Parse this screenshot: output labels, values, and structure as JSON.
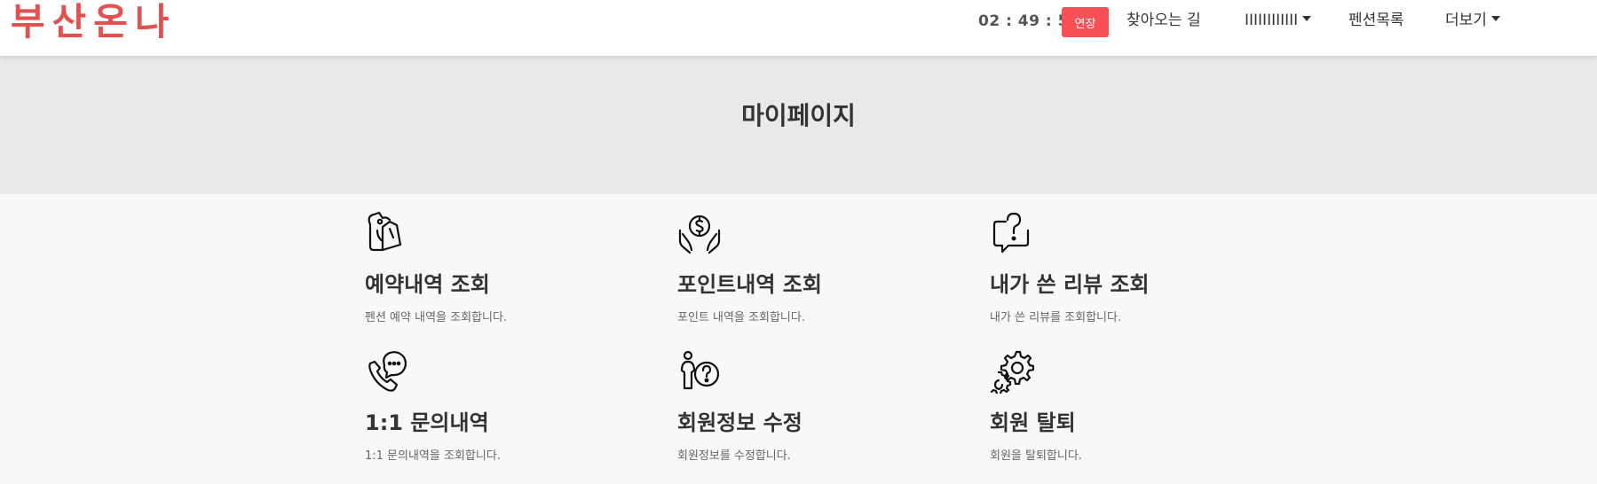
{
  "header": {
    "logo": "부산온나",
    "timer": "02 : 49 : 53",
    "extend_label": "연장",
    "nav": [
      {
        "label": "찾아오는 길"
      },
      {
        "label": "IIIIIIIIIIII"
      },
      {
        "label": "펜션목록"
      },
      {
        "label": "더보기"
      }
    ]
  },
  "hero": {
    "title": "마이페이지"
  },
  "cards": [
    {
      "title": "예약내역 조회",
      "desc": "펜션 예약 내역을 조회합니다.",
      "icon": "reservation-icon"
    },
    {
      "title": "포인트내역 조회",
      "desc": "포인트 내역을 조회합니다.",
      "icon": "point-coin-icon"
    },
    {
      "title": "내가 쓴 리뷰 조회",
      "desc": "내가 쓴 리뷰를 조회합니다.",
      "icon": "review-question-icon"
    },
    {
      "title": "1:1 문의내역",
      "desc": "1:1 문의내역을 조회합니다.",
      "icon": "phone-chat-icon"
    },
    {
      "title": "회원정보 수정",
      "desc": "회원정보를 수정합니다.",
      "icon": "user-question-icon"
    },
    {
      "title": "회원 탈퇴",
      "desc": "회원을 탈퇴합니다.",
      "icon": "gears-icon"
    }
  ],
  "colors": {
    "brand": "#e35050",
    "extend_button": "#f74f56",
    "hero_bg": "#e9e9e9"
  }
}
